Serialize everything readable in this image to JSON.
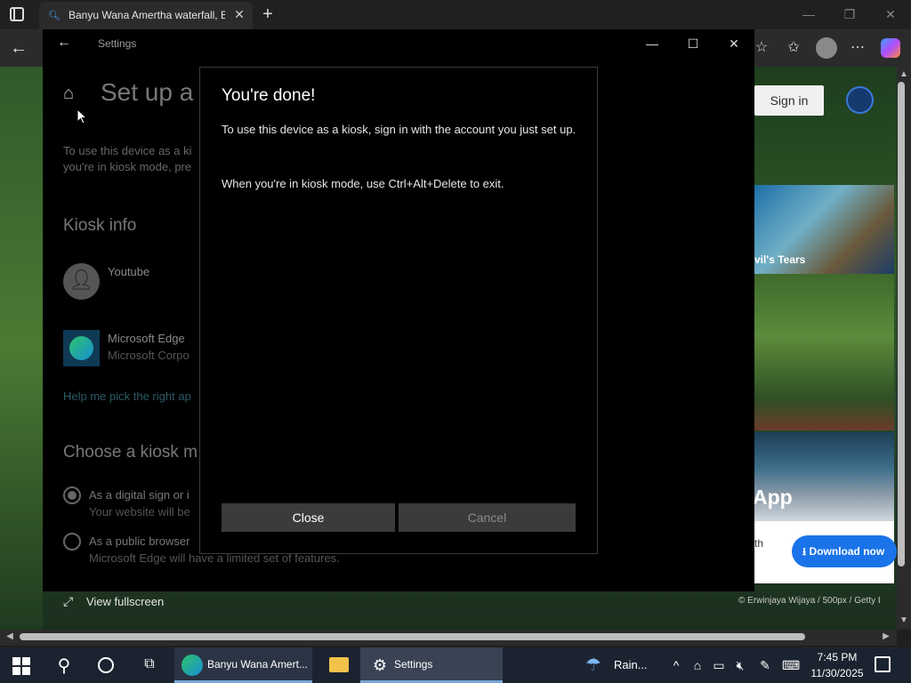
{
  "browser": {
    "tab_title": "Banyu Wana Amertha waterfall, B",
    "tab_close": "✕",
    "new_tab": "+",
    "win_min": "—",
    "win_max": "❐",
    "win_close": "✕",
    "back": "←"
  },
  "page": {
    "sign_in": "Sign in",
    "card1_label": "vil's Tears",
    "card3_label": "App",
    "promo_small": "th",
    "download_label": "⭳ Download now",
    "credit": "© Erwinjaya Wijaya / 500px / Getty I",
    "view_fullscreen": "View fullscreen"
  },
  "settings": {
    "window_title": "Settings",
    "page_title": "Set up a k",
    "intro": "To use this device as a ki you're in kiosk mode, pre",
    "kiosk_info_heading": "Kiosk info",
    "account_name": "Youtube",
    "app_name": "Microsoft Edge",
    "app_publisher": "Microsoft Corpo",
    "help_link": "Help me pick the right ap",
    "choose_mode_heading": "Choose a kiosk m",
    "option1_label": "As a digital sign or i",
    "option1_desc": "Your website will be",
    "option2_label": "As a public browser",
    "option2_desc": "Microsoft Edge will have a limited set of features."
  },
  "dialog": {
    "title": "You're done!",
    "paragraph1": "To use this device as a kiosk, sign in with the account you just set up.",
    "paragraph2": "When you're in kiosk mode, use Ctrl+Alt+Delete to exit.",
    "close_button": "Close",
    "cancel_button": "Cancel"
  },
  "taskbar": {
    "edge_label": "Banyu Wana Amert...",
    "settings_label": "Settings",
    "weather_label": "Rain...",
    "time": "7:45 PM",
    "date": "11/30/2025"
  }
}
